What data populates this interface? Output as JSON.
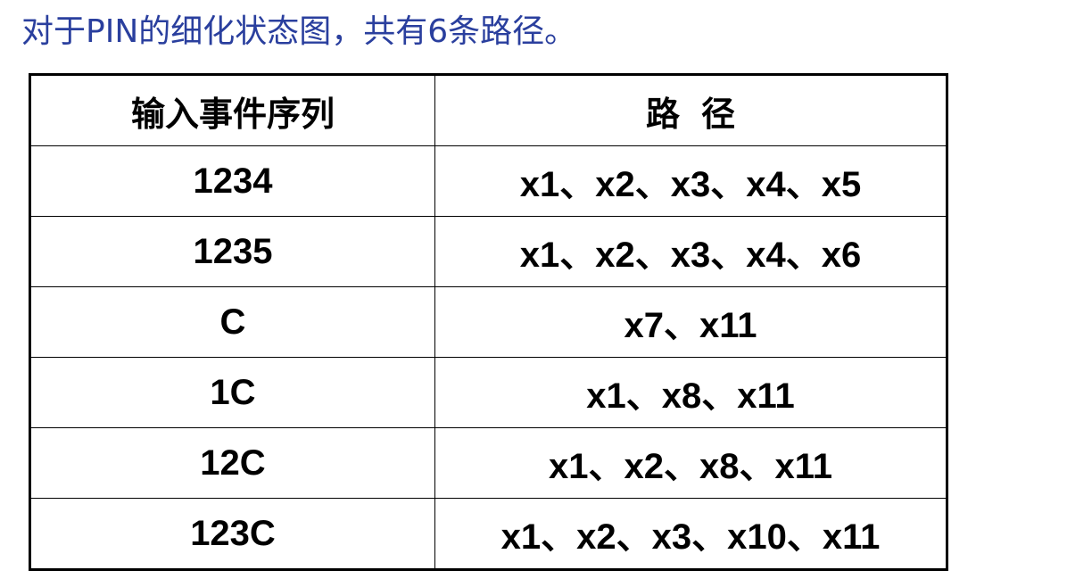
{
  "caption": "对于PIN的细化状态图，共有6条路径。",
  "table": {
    "headers": [
      "输入事件序列",
      "路 径"
    ],
    "rows": [
      {
        "sequence": "1234",
        "path": "x1、x2、x3、x4、x5"
      },
      {
        "sequence": "1235",
        "path": "x1、x2、x3、x4、x6"
      },
      {
        "sequence": "C",
        "path": "x7、x11"
      },
      {
        "sequence": "1C",
        "path": "x1、x8、x11"
      },
      {
        "sequence": "12C",
        "path": "x1、x2、x8、x11"
      },
      {
        "sequence": "123C",
        "path": "x1、x2、x3、x10、x11"
      }
    ]
  }
}
